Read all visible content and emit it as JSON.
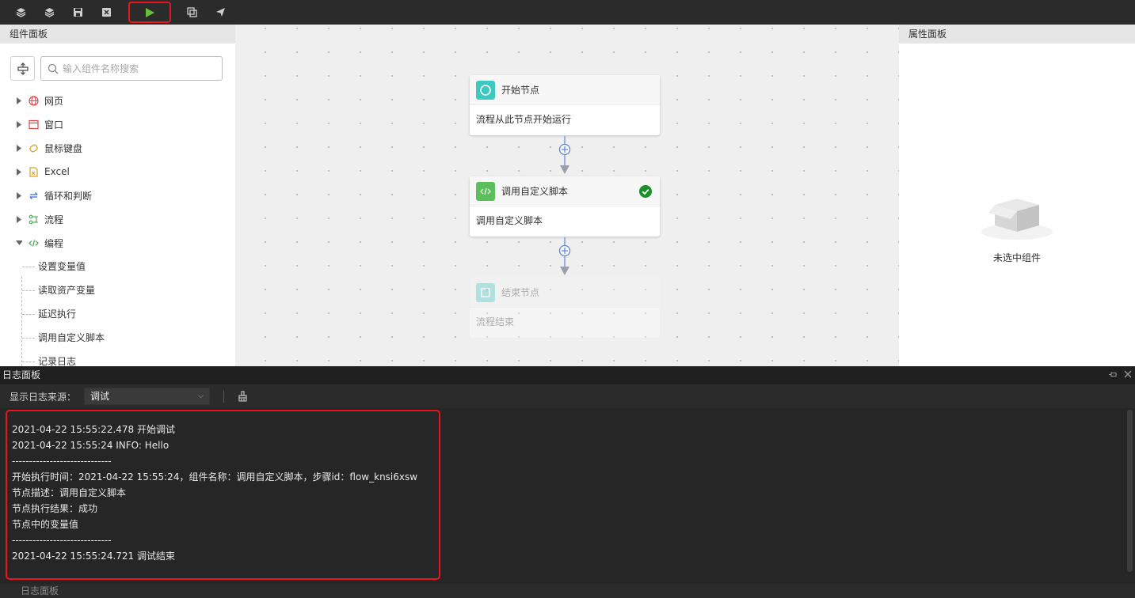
{
  "toolbar": {
    "buttons": [
      "layers-icon",
      "layers-alt-icon",
      "save-icon",
      "close-box-icon",
      "play-icon",
      "copy-icon",
      "send-icon"
    ],
    "highlight_color": "#e8141e",
    "run_color": "#6abf3a"
  },
  "left_panel": {
    "title": "组件面板",
    "search_placeholder": "输入组件名称搜索",
    "categories": [
      {
        "label": "网页",
        "icon": "globe-icon",
        "color": "#e04848",
        "expanded": false
      },
      {
        "label": "窗口",
        "icon": "window-icon",
        "color": "#e04848",
        "expanded": false
      },
      {
        "label": "鼠标键盘",
        "icon": "mouse-keyboard-icon",
        "color": "#e0a020",
        "expanded": false
      },
      {
        "label": "Excel",
        "icon": "excel-file-icon",
        "color": "#e0a020",
        "expanded": false
      },
      {
        "label": "循环和判断",
        "icon": "loop-icon",
        "color": "#3a6fd8",
        "expanded": false
      },
      {
        "label": "流程",
        "icon": "flow-icon",
        "color": "#3aa84a",
        "expanded": false
      },
      {
        "label": "编程",
        "icon": "code-icon",
        "color": "#3aa84a",
        "expanded": true
      }
    ],
    "sub_items": [
      "设置变量值",
      "读取资产变量",
      "延迟执行",
      "调用自定义脚本",
      "记录日志"
    ]
  },
  "canvas": {
    "nodes": [
      {
        "title": "开始节点",
        "desc": "流程从此节点开始运行",
        "icon": "circle-icon",
        "icon_color": "#3dc9c0",
        "status": ""
      },
      {
        "title": "调用自定义脚本",
        "desc": "调用自定义脚本",
        "icon": "code-icon",
        "icon_color": "#5bbf5b",
        "status": "success-check-icon"
      },
      {
        "title": "结束节点",
        "desc": "流程结束",
        "icon": "square-icon",
        "icon_color": "#3dc9c0",
        "status": ""
      }
    ]
  },
  "right_panel": {
    "title": "属性面板",
    "empty_label": "未选中组件"
  },
  "log_panel": {
    "title": "日志面板",
    "source_label": "显示日志来源：",
    "source_value": "调试",
    "lines": [
      "2021-04-22 15:55:22.478 开始调试",
      "2021-04-22 15:55:24 INFO: Hello",
      "-----------------------------",
      "开始执行时间：2021-04-22 15:55:24，组件名称：调用自定义脚本，步骤id：flow_knsi6xsw",
      "节点描述：调用自定义脚本",
      "节点执行结果：成功",
      "节点中的变量值",
      "-----------------------------",
      "2021-04-22 15:55:24.721 调试结束"
    ],
    "bottom_tab": "日志面板"
  }
}
